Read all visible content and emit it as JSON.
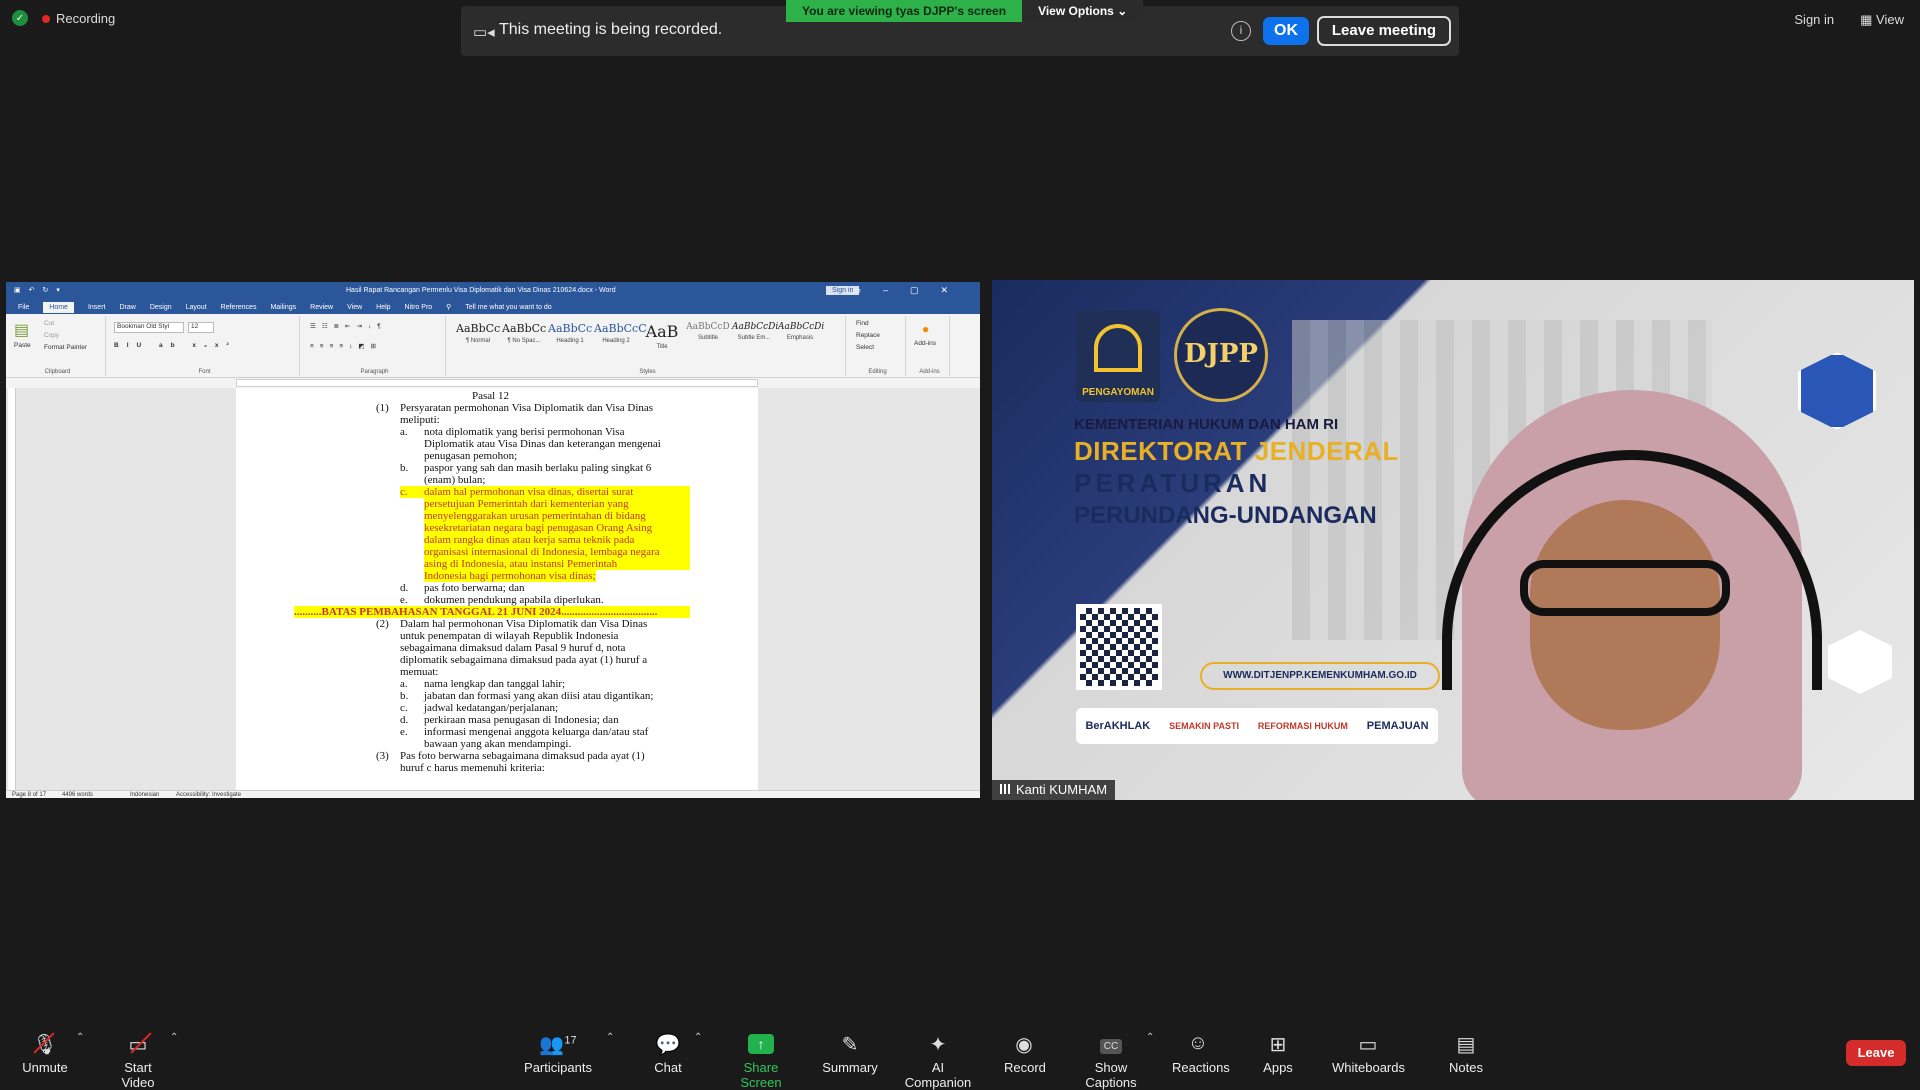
{
  "top": {
    "recording_label": "Recording",
    "sign_in": "Sign in",
    "view": "View"
  },
  "sharing_banner": {
    "viewing_text": "You are viewing tyas DJPP's screen",
    "view_options": "View Options"
  },
  "record_notice": {
    "message": "This meeting is being recorded.",
    "ok": "OK",
    "leave_meeting": "Leave meeting"
  },
  "word": {
    "title": "Hasil Rapat Rancangan Permenlu Visa Diplomatik dan Visa Dinas 210624.docx  -  Word",
    "sign_in": "Sign in",
    "tabs": [
      "File",
      "Home",
      "Insert",
      "Draw",
      "Design",
      "Layout",
      "References",
      "Mailings",
      "Review",
      "View",
      "Help",
      "Nitro Pro",
      "Tell me what you want to do"
    ],
    "ribbon": {
      "paste": "Paste",
      "cut": "Cut",
      "copy": "Copy",
      "format_painter": "Format Painter",
      "clipboard": "Clipboard",
      "font_name": "Bookman Old Styl",
      "font_size": "12",
      "font": "Font",
      "paragraph": "Paragraph",
      "styles_label": "Styles",
      "find": "Find",
      "replace": "Replace",
      "select": "Select",
      "editing": "Editing",
      "addins": "Add-ins",
      "addins_group": "Add-ins",
      "styles": [
        {
          "sample": "AaBbCc",
          "name": "¶ Normal"
        },
        {
          "sample": "AaBbCc",
          "name": "¶ No Spac..."
        },
        {
          "sample": "AaBbCc",
          "name": "Heading 1"
        },
        {
          "sample": "AaBbCcC",
          "name": "Heading 2"
        },
        {
          "sample": "AaB",
          "name": "Title"
        },
        {
          "sample": "AaBbCcD",
          "name": "Subtitle"
        },
        {
          "sample": "AaBbCcDi",
          "name": "Subtle Em..."
        },
        {
          "sample": "AaBbCcDi",
          "name": "Emphasis"
        }
      ]
    },
    "doc": {
      "heading": "Pasal 12",
      "p1": "(1)",
      "p1_text": "Persyaratan permohonan Visa Diplomatik dan Visa Dinas",
      "p1_text2": "meliputi:",
      "a1": "a.",
      "a1_l1": "nota diplomatik yang berisi permohonan Visa",
      "a1_l2": "Diplomatik atau Visa Dinas dan keterangan mengenai",
      "a1_l3": "penugasan pemohon;",
      "b1": "b.",
      "b1_l1": "paspor yang sah dan masih berlaku paling singkat 6",
      "b1_l2": "(enam) bulan;",
      "c1": "c.",
      "c1_lines": [
        "dalam hal permohonan visa dinas, disertai surat",
        "persetujuan Pemerintah dari kementerian yang",
        "menyelenggarakan urusan pemerintahan di bidang",
        "kesekretariatan negara bagi penugasan Orang Asing",
        "dalam rangka dinas atau kerja sama teknik pada",
        "organisasi internasional di Indonesia, lembaga negara",
        "asing di Indonesia, atau instansi Pemerintah",
        "Indonesia bagi permohonan visa dinas;"
      ],
      "d1": "d.",
      "d1_text": "pas foto berwarna; dan",
      "e1": "e.",
      "e1_text": "dokumen pendukung apabila diperlukan.",
      "batas": "..........BATAS PEMBAHASAN TANGGAL 21 JUNI 2024...................................",
      "p2": "(2)",
      "p2_lines": [
        "Dalam hal permohonan Visa Diplomatik dan Visa Dinas",
        "untuk penempatan di wilayah Republik Indonesia",
        "sebagaimana dimaksud dalam Pasal 9 huruf d, nota",
        "diplomatik sebagaimana dimaksud pada ayat (1) huruf a",
        "memuat:"
      ],
      "list2": [
        {
          "k": "a.",
          "t": "nama lengkap dan tanggal lahir;"
        },
        {
          "k": "b.",
          "t": "jabatan dan formasi yang akan diisi atau digantikan;"
        },
        {
          "k": "c.",
          "t": "jadwal kedatangan/perjalanan;"
        },
        {
          "k": "d.",
          "t": "perkiraan masa penugasan di Indonesia; dan"
        },
        {
          "k": "e.",
          "t": "informasi mengenai anggota keluarga dan/atau staf"
        }
      ],
      "list2_cont": "bawaan yang akan mendampingi.",
      "p3": "(3)",
      "p3_l1": "Pas foto berwarna sebagaimana dimaksud pada ayat (1)",
      "p3_l2": "huruf c harus memenuhi kriteria:"
    },
    "status": {
      "page": "Page 8 of 17",
      "words": "4496 words",
      "language": "Indonesian",
      "accessibility": "Accessibility: Investigate"
    }
  },
  "video": {
    "kementerian": "KEMENTERIAN HUKUM DAN HAM RI",
    "direktorat": "DIREKTORAT JENDERAL",
    "peraturan": "PERATURAN",
    "perundang": "PERUNDANG-UNDANGAN",
    "pengayoman": "PENGAYOMAN",
    "djpp": "DJPP",
    "url": "WWW.DITJENPP.KEMENKUMHAM.GO.ID",
    "badges": [
      "BerAKHLAK",
      "SEMAKIN PASTI",
      "REFORMASI HUKUM",
      "PEMAJUAN"
    ],
    "participant_name": "Kanti KUMHAM"
  },
  "toolbar": {
    "unmute": "Unmute",
    "start_video": "Start Video",
    "participants": "Participants",
    "participants_count": "17",
    "chat": "Chat",
    "share_screen": "Share Screen",
    "summary": "Summary",
    "ai_companion": "AI Companion",
    "record": "Record",
    "show_captions": "Show Captions",
    "reactions": "Reactions",
    "apps": "Apps",
    "whiteboards": "Whiteboards",
    "notes": "Notes",
    "leave": "Leave"
  },
  "colors": {
    "share_green": "#2fb14a",
    "ok_blue": "#0e72ed",
    "leave_red": "#d42b2b",
    "word_blue": "#2b579a",
    "highlight": "#ffff00"
  }
}
